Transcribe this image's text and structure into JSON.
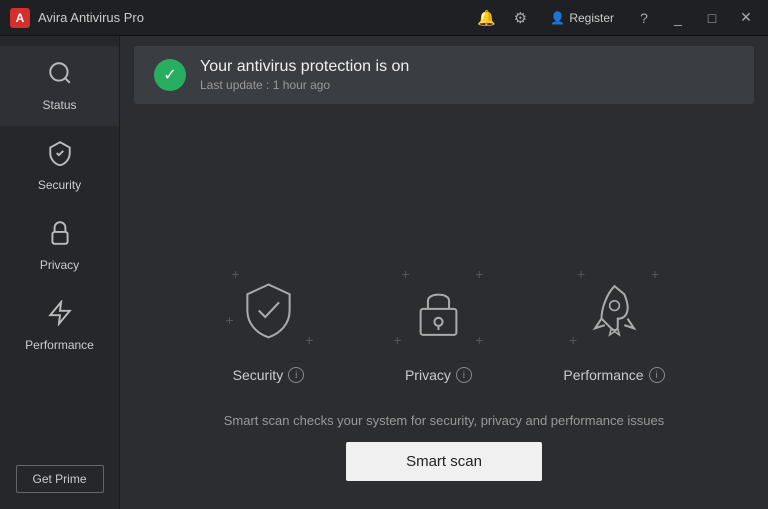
{
  "titleBar": {
    "logo": "A",
    "title": "Avira Antivirus Pro",
    "helpLabel": "?",
    "minimizeLabel": "_",
    "maximizeLabel": "□",
    "closeLabel": "✕",
    "registerLabel": "Register",
    "colors": {
      "logoBackground": "#d32f2f"
    }
  },
  "sidebar": {
    "items": [
      {
        "id": "status",
        "label": "Status",
        "icon": "🔍",
        "active": true
      },
      {
        "id": "security",
        "label": "Security",
        "icon": "✓",
        "active": false
      },
      {
        "id": "privacy",
        "label": "Privacy",
        "icon": "🔒",
        "active": false
      },
      {
        "id": "performance",
        "label": "Performance",
        "icon": "🚀",
        "active": false
      }
    ],
    "getPrimeLabel": "Get Prime"
  },
  "statusBar": {
    "mainText": "Your antivirus protection is on",
    "subText": "Last update : 1 hour ago"
  },
  "features": [
    {
      "id": "security",
      "label": "Security"
    },
    {
      "id": "privacy",
      "label": "Privacy"
    },
    {
      "id": "performance",
      "label": "Performance"
    }
  ],
  "bottomSection": {
    "description": "Smart scan checks your system for security, privacy and performance issues",
    "buttonLabel": "Smart scan"
  }
}
